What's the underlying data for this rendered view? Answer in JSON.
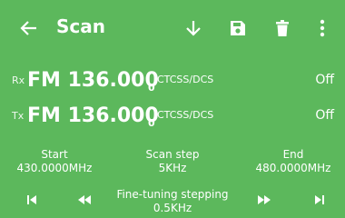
{
  "colors": {
    "background": "#5cb85c",
    "text": "#ffffff"
  },
  "header": {
    "title": "Scan",
    "icons": [
      "arrow-left-icon",
      "arrow-down-icon",
      "save-icon",
      "trash-icon",
      "more-vertical-icon"
    ]
  },
  "rx": {
    "label": "Rx",
    "frequency": "FM 136.000",
    "subdigit": "0",
    "tone_label": "CTCSS/DCS",
    "tone_value": "Off"
  },
  "tx": {
    "label": "Tx",
    "frequency": "FM 136.000",
    "subdigit": "0",
    "tone_label": "CTCSS/DCS",
    "tone_value": "Off"
  },
  "params": {
    "start": {
      "label": "Start",
      "value": "430.0000MHz"
    },
    "step": {
      "label": "Scan step",
      "value": "5KHz"
    },
    "end": {
      "label": "End",
      "value": "480.0000MHz"
    }
  },
  "controls": {
    "fine_label": "Fine-tuning stepping",
    "fine_value": "0.5KHz",
    "icons": [
      "skip-first-icon",
      "rewind-icon",
      "fast-forward-icon",
      "skip-last-icon"
    ]
  }
}
